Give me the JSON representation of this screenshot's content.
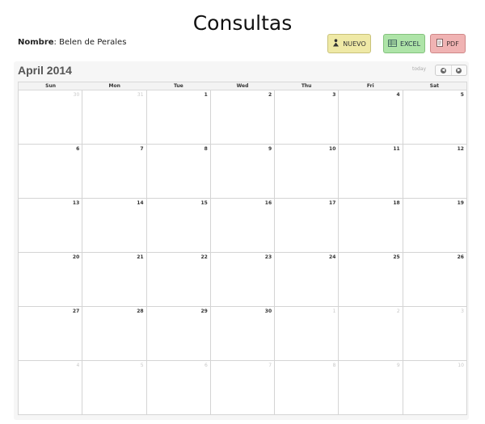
{
  "page": {
    "title": "Consultas"
  },
  "patient": {
    "label": "Nombre",
    "name": ": Belen de Perales"
  },
  "buttons": {
    "nuevo": {
      "label": "NUEVO",
      "icon": "person-plus-icon"
    },
    "excel": {
      "label": "EXCEL",
      "icon": "spreadsheet-icon"
    },
    "pdf": {
      "label": "PDF",
      "icon": "document-icon"
    }
  },
  "colors": {
    "nuevo": "#efe9a6",
    "excel": "#aee4a8",
    "pdf": "#f0b3b3"
  },
  "calendar": {
    "month_title": "April 2014",
    "today_label": "today",
    "prev_icon": "chevron-left-icon",
    "next_icon": "chevron-right-icon",
    "weekdays": [
      "Sun",
      "Mon",
      "Tue",
      "Wed",
      "Thu",
      "Fri",
      "Sat"
    ],
    "weeks": [
      [
        {
          "d": "30",
          "o": true
        },
        {
          "d": "31",
          "o": true
        },
        {
          "d": "1",
          "o": false
        },
        {
          "d": "2",
          "o": false
        },
        {
          "d": "3",
          "o": false
        },
        {
          "d": "4",
          "o": false
        },
        {
          "d": "5",
          "o": false
        }
      ],
      [
        {
          "d": "6",
          "o": false
        },
        {
          "d": "7",
          "o": false
        },
        {
          "d": "8",
          "o": false
        },
        {
          "d": "9",
          "o": false
        },
        {
          "d": "10",
          "o": false
        },
        {
          "d": "11",
          "o": false
        },
        {
          "d": "12",
          "o": false
        }
      ],
      [
        {
          "d": "13",
          "o": false
        },
        {
          "d": "14",
          "o": false
        },
        {
          "d": "15",
          "o": false
        },
        {
          "d": "16",
          "o": false
        },
        {
          "d": "17",
          "o": false
        },
        {
          "d": "18",
          "o": false
        },
        {
          "d": "19",
          "o": false
        }
      ],
      [
        {
          "d": "20",
          "o": false
        },
        {
          "d": "21",
          "o": false
        },
        {
          "d": "22",
          "o": false
        },
        {
          "d": "23",
          "o": false
        },
        {
          "d": "24",
          "o": false
        },
        {
          "d": "25",
          "o": false
        },
        {
          "d": "26",
          "o": false
        }
      ],
      [
        {
          "d": "27",
          "o": false
        },
        {
          "d": "28",
          "o": false
        },
        {
          "d": "29",
          "o": false
        },
        {
          "d": "30",
          "o": false
        },
        {
          "d": "1",
          "o": true
        },
        {
          "d": "2",
          "o": true
        },
        {
          "d": "3",
          "o": true
        }
      ],
      [
        {
          "d": "4",
          "o": true
        },
        {
          "d": "5",
          "o": true
        },
        {
          "d": "6",
          "o": true
        },
        {
          "d": "7",
          "o": true
        },
        {
          "d": "8",
          "o": true
        },
        {
          "d": "9",
          "o": true
        },
        {
          "d": "10",
          "o": true
        }
      ]
    ]
  }
}
